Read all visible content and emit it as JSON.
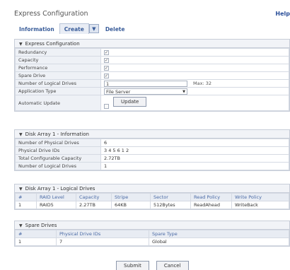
{
  "page": {
    "title": "Express Configuration",
    "help": "Help"
  },
  "tabs": [
    {
      "label": "Information"
    },
    {
      "label": "Create",
      "active": true
    },
    {
      "label": "Delete"
    }
  ],
  "icons": {
    "expand": "triangle-down-icon",
    "tab_menu": "dropdown-caret-icon",
    "checkbox": "checkbox-checked-icon"
  },
  "express": {
    "title": "Express Configuration",
    "rows": [
      {
        "label": "Redundancy",
        "checked": true
      },
      {
        "label": "Capacity",
        "checked": true
      },
      {
        "label": "Performance",
        "checked": true
      },
      {
        "label": "Spare Drive",
        "checked": true
      }
    ],
    "num_drives": {
      "label": "Number of Logical Drives",
      "value": "1",
      "max": "Max: 32"
    },
    "app_type": {
      "label": "Application Type",
      "value": "File Server"
    },
    "auto_update": {
      "label": "Automatic Update",
      "checked": false,
      "button": "Update"
    }
  },
  "disk_info": {
    "title": "Disk Array 1 - Information",
    "rows": [
      {
        "label": "Number of Physical Drives",
        "value": "6"
      },
      {
        "label": "Physical Drive IDs",
        "value": "3 4 5 6 1 2"
      },
      {
        "label": "Total Configurable Capacity",
        "value": "2.72TB"
      },
      {
        "label": "Number of Logical Drives",
        "value": "1"
      }
    ]
  },
  "logical": {
    "title": "Disk Array 1 - Logical Drives",
    "headers": [
      "#",
      "RAID Level",
      "Capacity",
      "Stripe",
      "Sector",
      "Read Policy",
      "Write Policy"
    ],
    "rows": [
      [
        "1",
        "RAID5",
        "2.27TB",
        "64KB",
        "512Bytes",
        "ReadAhead",
        "WriteBack"
      ]
    ]
  },
  "spare": {
    "title": "Spare Drives",
    "headers": [
      "#",
      "Physical Drive IDs",
      "Spare Type"
    ],
    "rows": [
      [
        "1",
        "7",
        "Global"
      ]
    ]
  },
  "footer": {
    "submit": "Submit",
    "cancel": "Cancel"
  }
}
